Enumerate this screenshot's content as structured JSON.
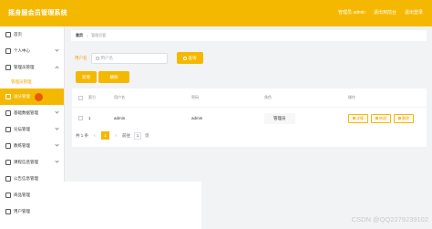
{
  "header": {
    "title": "摇身服会员管理系统",
    "user_text": "管理员 admin",
    "home_link": "退出到前台",
    "logout_link": "退出登录"
  },
  "sidebar": {
    "items": [
      {
        "label": "首页",
        "icon": "home-icon",
        "has_chevron": false
      },
      {
        "label": "个人中心",
        "icon": "user-icon",
        "has_chevron": true
      },
      {
        "label": "管理员管理",
        "icon": "admin-icon",
        "has_chevron": true,
        "expanded": true
      },
      {
        "label": "管理员管理",
        "submenu": true
      },
      {
        "label": "送分管理",
        "icon": "gift-icon",
        "has_chevron": true,
        "active": true
      },
      {
        "label": "基础数据管理",
        "icon": "data-icon",
        "has_chevron": true
      },
      {
        "label": "论坛管理",
        "icon": "forum-icon",
        "has_chevron": true
      },
      {
        "label": "教练管理",
        "icon": "coach-icon",
        "has_chevron": true
      },
      {
        "label": "课程信息管理",
        "icon": "course-icon",
        "has_chevron": true
      },
      {
        "label": "公告信息管理",
        "icon": "notice-icon",
        "has_chevron": false
      },
      {
        "label": "商品管理",
        "icon": "goods-icon",
        "has_chevron": false
      },
      {
        "label": "用户管理",
        "icon": "users-icon",
        "has_chevron": false
      }
    ]
  },
  "breadcrumb": {
    "home": "首页",
    "separator": "/",
    "current": "管理员管"
  },
  "search": {
    "label": "用户名",
    "placeholder": "用户名",
    "button": "查询"
  },
  "actions": {
    "add": "新增",
    "delete": "删除"
  },
  "table": {
    "headers": [
      "索引",
      "用户名",
      "密码",
      "角色",
      "操作"
    ],
    "rows": [
      {
        "index": "1",
        "username": "admin",
        "password": "admin",
        "role": "管理员"
      }
    ],
    "row_actions": [
      "详情",
      "修改",
      "删除"
    ]
  },
  "pager": {
    "total": "共 1 条",
    "prev": "<",
    "current": "1",
    "next": ">",
    "goto_label": "前往",
    "goto_value": "1",
    "page_unit": "页"
  },
  "watermark": "CSDN @QQ2279239102",
  "colors": {
    "accent": "#f5b800",
    "active_dot": "#e8590c"
  }
}
